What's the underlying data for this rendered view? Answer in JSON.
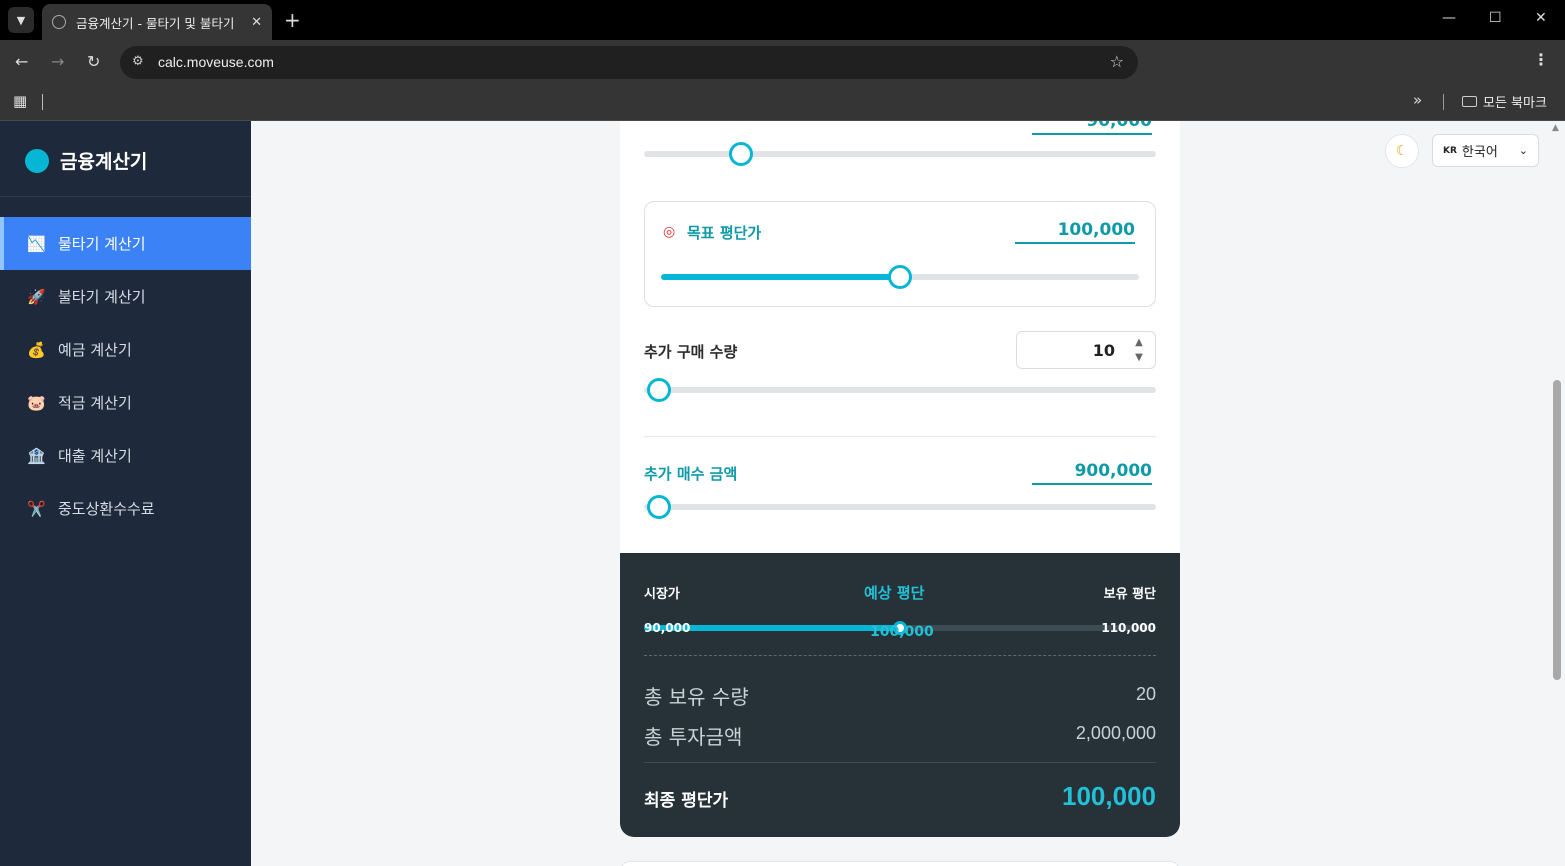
{
  "browser": {
    "tab_title": "금융계산기 - 물타기 및 불타기",
    "url": "calc.moveuse.com",
    "bookmarks_all": "모든 북마크"
  },
  "sidebar": {
    "brand": "금융계산기",
    "items": [
      {
        "label": "물타기 계산기",
        "icon": "chart-down-icon",
        "glyph": "📉",
        "active": true
      },
      {
        "label": "불타기 계산기",
        "icon": "rocket-icon",
        "glyph": "🚀",
        "active": false
      },
      {
        "label": "예금 계산기",
        "icon": "money-bag-icon",
        "glyph": "💰",
        "active": false
      },
      {
        "label": "적금 계산기",
        "icon": "piggy-bank-icon",
        "glyph": "🐷",
        "active": false
      },
      {
        "label": "대출 계산기",
        "icon": "bank-icon",
        "glyph": "🏦",
        "active": false
      },
      {
        "label": "중도상환수수료",
        "icon": "scissors-icon",
        "glyph": "✂️",
        "active": false
      }
    ]
  },
  "header": {
    "theme_icon": "moon-icon",
    "language": {
      "flag": "KR",
      "selected": "한국어"
    }
  },
  "form": {
    "current_price": {
      "value": "90,000",
      "slider_fraction": 0.19
    },
    "target_avg": {
      "label": "목표 평단가",
      "icon": "target-icon",
      "value": "100,000",
      "slider_fraction": 0.5
    },
    "add_quantity": {
      "label": "추가 구매 수량",
      "value": "10",
      "slider_fraction": 0.03
    },
    "add_amount": {
      "label": "추가 매수 금액",
      "value": "900,000",
      "slider_fraction": 0.03
    }
  },
  "summary": {
    "market_label": "시장가",
    "expected_label": "예상 평단",
    "holding_label": "보유 평단",
    "market_value": "90,000",
    "expected_value": "100,000",
    "holding_value": "110,000",
    "expected_fraction": 0.5,
    "total_qty_label": "총 보유 수량",
    "total_qty_value": "20",
    "total_invest_label": "총 투자금액",
    "total_invest_value": "2,000,000",
    "final_label": "최종 평단가",
    "final_value": "100,000"
  },
  "colors": {
    "accent": "#06b6d4",
    "sidebar_bg": "#1e293b",
    "active_item": "#3b82f6",
    "summary_bg": "#263238"
  }
}
